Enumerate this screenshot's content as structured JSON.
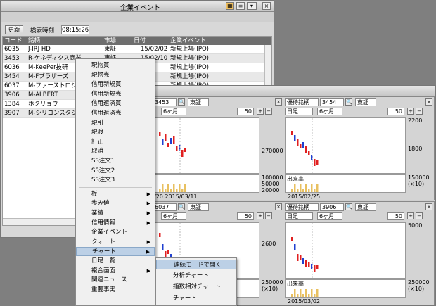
{
  "back_window": {
    "title": "企業イベント",
    "refresh_label": "更新",
    "search_time_label": "検索時刻",
    "search_time": "08:15:26",
    "columns": [
      "コード",
      "銘柄",
      "市場",
      "日付",
      "企業イベント"
    ],
    "rows": [
      {
        "code": "6035",
        "name": "J-IRJ HD",
        "market": "東証",
        "date": "15/02/02",
        "event": "新規上場(IPO)"
      },
      {
        "code": "3453",
        "name": "R-ケネディクス商業",
        "market": "東証",
        "date": "15/02/10",
        "event": "新規上場(IPO)"
      },
      {
        "code": "6036",
        "name": "M-KeePer技研",
        "market": "",
        "date": "2/12",
        "event": "新規上場(IPO)"
      },
      {
        "code": "3454",
        "name": "M-Fブラザーズ",
        "market": "",
        "date": "2/18",
        "event": "新規上場(IPO)"
      },
      {
        "code": "6037",
        "name": "M-ファーストロジ",
        "market": "",
        "date": "2/18",
        "event": "新規上場(IPO)"
      },
      {
        "code": "3906",
        "name": "M-ALBERT",
        "market": "",
        "date": "",
        "event": ""
      },
      {
        "code": "1384",
        "name": "ホクリョウ",
        "market": "",
        "date": "",
        "event": ""
      },
      {
        "code": "3907",
        "name": "M-シリコンスタジオ",
        "market": "",
        "date": "",
        "event": ""
      }
    ]
  },
  "chart_window": {
    "panels": [
      {
        "code": "3453",
        "market": "東証",
        "period": "6ヶ月",
        "count": "50",
        "date_label": "/20  2015/03/11",
        "prices": [
          "270000"
        ],
        "vol": [
          "100000",
          "50000",
          "20000"
        ]
      },
      {
        "code": "3454",
        "market": "東証",
        "type": "優待銘柄",
        "chart": "日足",
        "period": "6ヶ月",
        "count": "50",
        "date_label": "2015/02/25",
        "prices": [
          "2200",
          "1800"
        ],
        "vol_title": "出来高",
        "vol": [
          "150000",
          "(×10)"
        ]
      },
      {
        "code": "6037",
        "market": "東証",
        "period": "6ヶ月",
        "count": "50",
        "prices": [
          "2600"
        ],
        "vol": [
          "250000",
          "(×10)"
        ]
      },
      {
        "code": "3906",
        "market": "東証",
        "type": "優待銘柄",
        "chart": "日足",
        "period": "6ヶ月",
        "count": "50",
        "date_label": "2015/03/02",
        "prices": [
          "5000"
        ],
        "vol_title": "出来高",
        "vol": [
          "250000",
          "(×10)"
        ]
      }
    ]
  },
  "context_menu": {
    "items": [
      {
        "label": "現物買",
        "sub": false
      },
      {
        "label": "現物売",
        "sub": false
      },
      {
        "label": "信用新規買",
        "sub": false
      },
      {
        "label": "信用新規売",
        "sub": false
      },
      {
        "label": "信用返済買",
        "sub": false
      },
      {
        "label": "信用返済売",
        "sub": false
      },
      {
        "label": "現引",
        "sub": false
      },
      {
        "label": "現渡",
        "sub": false
      },
      {
        "label": "訂正",
        "sub": false
      },
      {
        "label": "取消",
        "sub": false
      },
      {
        "label": "SS注文1",
        "sub": false
      },
      {
        "label": "SS注文2",
        "sub": false
      },
      {
        "label": "SS注文3",
        "sub": false
      },
      {
        "label": "板",
        "sub": true
      },
      {
        "label": "歩み値",
        "sub": true
      },
      {
        "label": "業績",
        "sub": true
      },
      {
        "label": "信用情報",
        "sub": true
      },
      {
        "label": "企業イベント",
        "sub": false
      },
      {
        "label": "クォート",
        "sub": true
      },
      {
        "label": "チャート",
        "sub": true
      },
      {
        "label": "日足一覧",
        "sub": false
      },
      {
        "label": "複合画面",
        "sub": true
      },
      {
        "label": "関連ニュース",
        "sub": false
      },
      {
        "label": "重要事実",
        "sub": false
      }
    ],
    "submenu": [
      "連続モードで開く",
      "分析チャート",
      "指数相対チャート",
      "チャート"
    ]
  }
}
